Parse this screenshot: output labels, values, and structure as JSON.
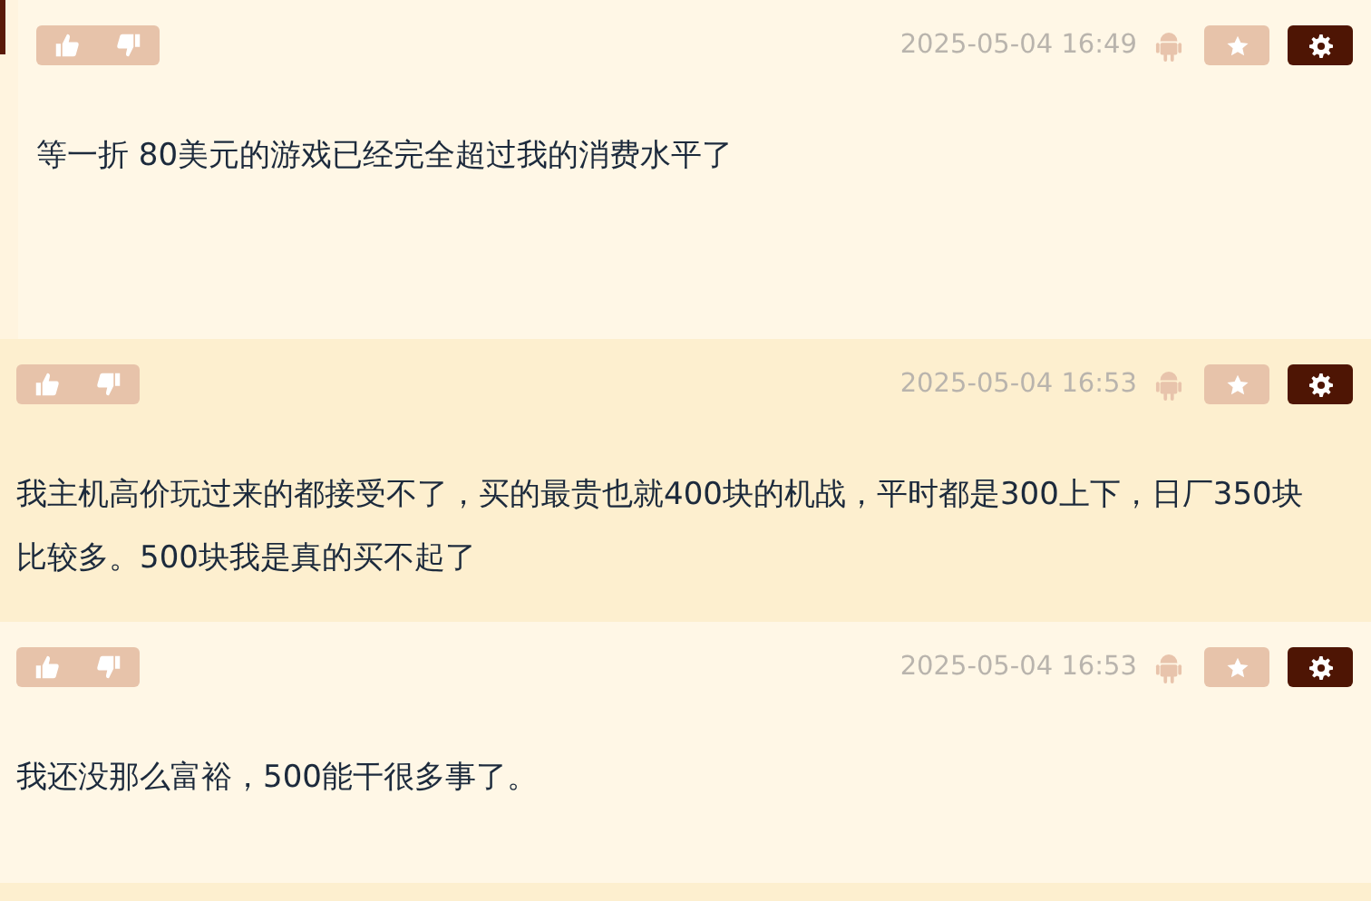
{
  "comments": [
    {
      "kind": "reply",
      "highlighted": false,
      "time": "2025-05-04 16:49",
      "text": "等一折 80美元的游戏已经完全超过我的消费水平了"
    },
    {
      "kind": "top",
      "highlighted": true,
      "time": "2025-05-04 16:53",
      "text": "我主机高价玩过来的都接受不了，买的最贵也就400块的机战，平时都是300上下，日厂350块比较多。500块我是真的买不起了"
    },
    {
      "kind": "top",
      "highlighted": false,
      "time": "2025-05-04 16:53",
      "text": "我还没那么富裕，500能干很多事了。"
    }
  ]
}
